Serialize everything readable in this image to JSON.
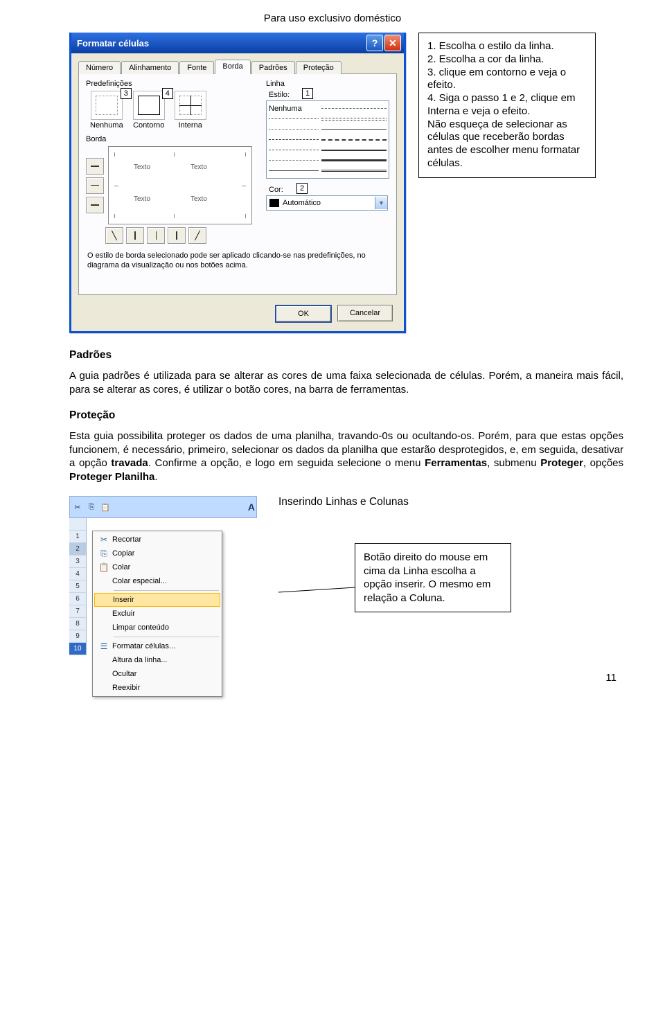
{
  "header": "Para uso exclusivo doméstico",
  "dialog": {
    "title": "Formatar células",
    "tabs": [
      "Número",
      "Alinhamento",
      "Fonte",
      "Borda",
      "Padrões",
      "Proteção"
    ],
    "active_tab": "Borda",
    "predef_label": "Predefinições",
    "presets": {
      "none": "Nenhuma",
      "outline": "Contorno",
      "inside": "Interna"
    },
    "borda_label": "Borda",
    "preview_text": "Texto",
    "linha_label": "Linha",
    "estilo_label": "Estilo:",
    "style_none": "Nenhuma",
    "cor_label": "Cor:",
    "cor_value": "Automático",
    "hint_text": "O estilo de borda selecionado pode ser aplicado clicando-se nas predefinições, no diagrama da visualização ou nos botões acima.",
    "ok": "OK",
    "cancel": "Cancelar"
  },
  "callouts": {
    "c1": "1",
    "c2": "2",
    "c3": "3",
    "c4": "4"
  },
  "instructions": {
    "l1": "1. Escolha o estilo da linha.",
    "l2": "2. Escolha a cor da linha.",
    "l3": "3. clique em contorno e veja o efeito.",
    "l4": "4. Siga o passo 1 e 2, clique em Interna e veja o efeito.",
    "l5": "Não esqueça de selecionar as células que receberão bordas antes de escolher menu formatar células."
  },
  "body": {
    "h1": "Padrões",
    "p1": "A guia padrões é utilizada para se alterar as cores de uma faixa selecionada de células. Porém, a maneira mais fácil, para se alterar as cores, é utilizar o botão cores, na barra de ferramentas.",
    "h2": "Proteção",
    "p2a": "Esta guia possibilita proteger os dados de uma planilha, travando-0s ou ocultando-os. Porém, para que estas opções funcionem, é necessário, primeiro, selecionar os dados da planilha que estarão desprotegidos, e, em seguida, desativar a opção ",
    "p2b": "travada",
    "p2c": ". Confirme a opção, e logo em seguida selecione o menu ",
    "p2d": "Ferramentas",
    "p2e": ", submenu ",
    "p2f": "Proteger",
    "p2g": ", opções ",
    "p2h": "Proteger Planilha",
    "p2i": ".",
    "h3": "Inserindo Linhas e Colunas"
  },
  "cmenu": {
    "items": [
      {
        "label": "Recortar",
        "icon": "✂"
      },
      {
        "label": "Copiar",
        "icon": "⎘"
      },
      {
        "label": "Colar",
        "icon": "📋"
      },
      {
        "label": "Colar especial...",
        "icon": ""
      },
      {
        "label": "Inserir",
        "icon": "",
        "selected": true
      },
      {
        "label": "Excluir",
        "icon": ""
      },
      {
        "label": "Limpar conteúdo",
        "icon": ""
      },
      {
        "label": "Formatar células...",
        "icon": "☰"
      },
      {
        "label": "Altura da linha...",
        "icon": ""
      },
      {
        "label": "Ocultar",
        "icon": ""
      },
      {
        "label": "Reexibir",
        "icon": ""
      }
    ],
    "underlines": [
      "R",
      "C",
      "C",
      "s",
      "I",
      "E",
      "L",
      "F",
      "A",
      "O",
      "x"
    ]
  },
  "callout2": "Botão direito do mouse em cima da Linha escolha a opção inserir. O mesmo em relação a Coluna.",
  "page_number": "11"
}
